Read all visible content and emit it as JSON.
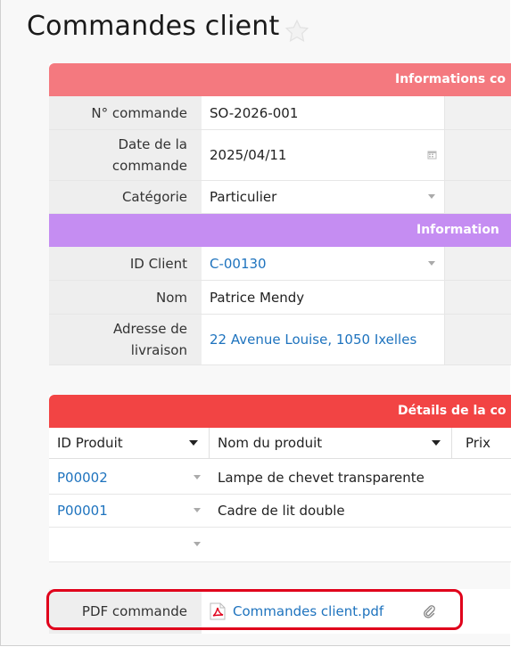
{
  "page": {
    "title": "Commandes client"
  },
  "order_section": {
    "header": "Informations co",
    "color": "#f4797f",
    "fields": [
      {
        "label": "N° commande",
        "value": "SO-2026-001"
      },
      {
        "label": "Date de la commande",
        "value": "2025/04/11"
      },
      {
        "label": "Catégorie",
        "value": "Particulier"
      }
    ]
  },
  "client_section": {
    "header": "Information",
    "color": "#c58df2",
    "fields": [
      {
        "label": "ID Client",
        "value": "C-00130"
      },
      {
        "label": "Nom",
        "value": "Patrice Mendy"
      },
      {
        "label": "Adresse de livraison",
        "value": "22 Avenue Louise, 1050 Ixelles"
      }
    ]
  },
  "details_section": {
    "header": "Détails de la co",
    "color": "#f24444",
    "columns": [
      "ID Produit",
      "Nom du produit",
      "Prix"
    ],
    "rows": [
      {
        "id": "P00002",
        "name": "Lampe de chevet transparente"
      },
      {
        "id": "P00001",
        "name": "Cadre de lit double"
      }
    ]
  },
  "pdf": {
    "label": "PDF commande",
    "file": "Commandes client.pdf"
  },
  "colors": {
    "link": "#1e73be",
    "highlight": "#e0001b"
  }
}
